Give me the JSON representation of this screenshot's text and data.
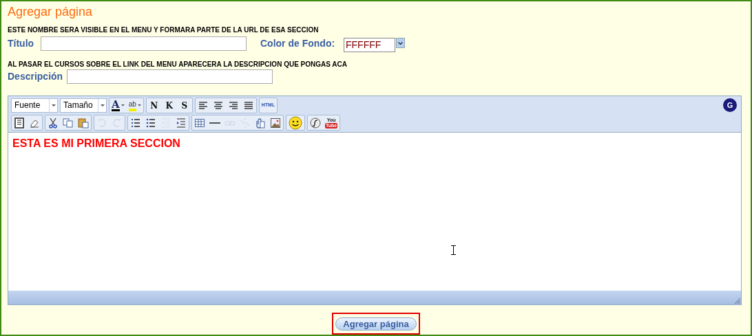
{
  "page": {
    "title": "Agregar página"
  },
  "form": {
    "name_hint": "ESTE NOMBRE SERA VISIBLE EN EL MENU Y FORMARA PARTE DE LA URL DE ESA SECCION",
    "title_label": "Título",
    "color_label": "Color de Fondo:",
    "color_value": "FFFFFF",
    "description_hint": "AL PASAR EL CURSOS SOBRE EL LINK DEL MENU APARECERA LA DESCRIPCION QUE PONGAS ACA",
    "description_label": "Descripción"
  },
  "editor": {
    "toolbar_rows": [
      [
        [
          {
            "kind": "select",
            "label": "Fuente"
          }
        ],
        [
          {
            "kind": "select",
            "label": "Tamaño"
          }
        ],
        [
          {
            "kind": "text-color",
            "label": "A",
            "disabled": false
          },
          {
            "kind": "highlight",
            "label": "ab",
            "disabled": false
          }
        ],
        [
          {
            "kind": "letter",
            "label": "N",
            "disabled": false
          },
          {
            "kind": "letter",
            "label": "K",
            "disabled": false
          },
          {
            "kind": "letter",
            "label": "S",
            "disabled": false
          }
        ],
        [
          {
            "kind": "align-left",
            "disabled": false
          },
          {
            "kind": "align-center",
            "disabled": false
          },
          {
            "kind": "align-right",
            "disabled": false
          },
          {
            "kind": "justify",
            "disabled": false
          }
        ],
        [
          {
            "kind": "small-letter",
            "label": "HTML",
            "disabled": false
          }
        ]
      ],
      [
        [
          {
            "kind": "source",
            "disabled": false
          },
          {
            "kind": "eraser",
            "disabled": false
          }
        ],
        [
          {
            "kind": "cut",
            "disabled": false
          },
          {
            "kind": "copy",
            "disabled": false
          },
          {
            "kind": "paste",
            "disabled": false
          }
        ],
        [
          {
            "kind": "undo",
            "disabled": true
          },
          {
            "kind": "redo",
            "disabled": true
          }
        ],
        [
          {
            "kind": "ordered-list",
            "disabled": false
          },
          {
            "kind": "bullet-list",
            "disabled": false
          },
          {
            "kind": "outdent",
            "disabled": true
          },
          {
            "kind": "indent",
            "disabled": false
          }
        ],
        [
          {
            "kind": "table",
            "disabled": false
          },
          {
            "kind": "rule",
            "disabled": false
          },
          {
            "kind": "link",
            "disabled": true
          },
          {
            "kind": "unlink",
            "disabled": true
          },
          {
            "kind": "attach",
            "disabled": false
          },
          {
            "kind": "image",
            "disabled": false
          }
        ],
        [
          {
            "kind": "smiley",
            "disabled": false
          }
        ],
        [
          {
            "kind": "flash",
            "disabled": false
          },
          {
            "kind": "video",
            "label": "You",
            "label2": "Tube",
            "disabled": false
          }
        ]
      ]
    ],
    "badge": "G",
    "content": "ESTA ES MI PRIMERA SECCION"
  },
  "submit": {
    "label": "Agregar página"
  }
}
